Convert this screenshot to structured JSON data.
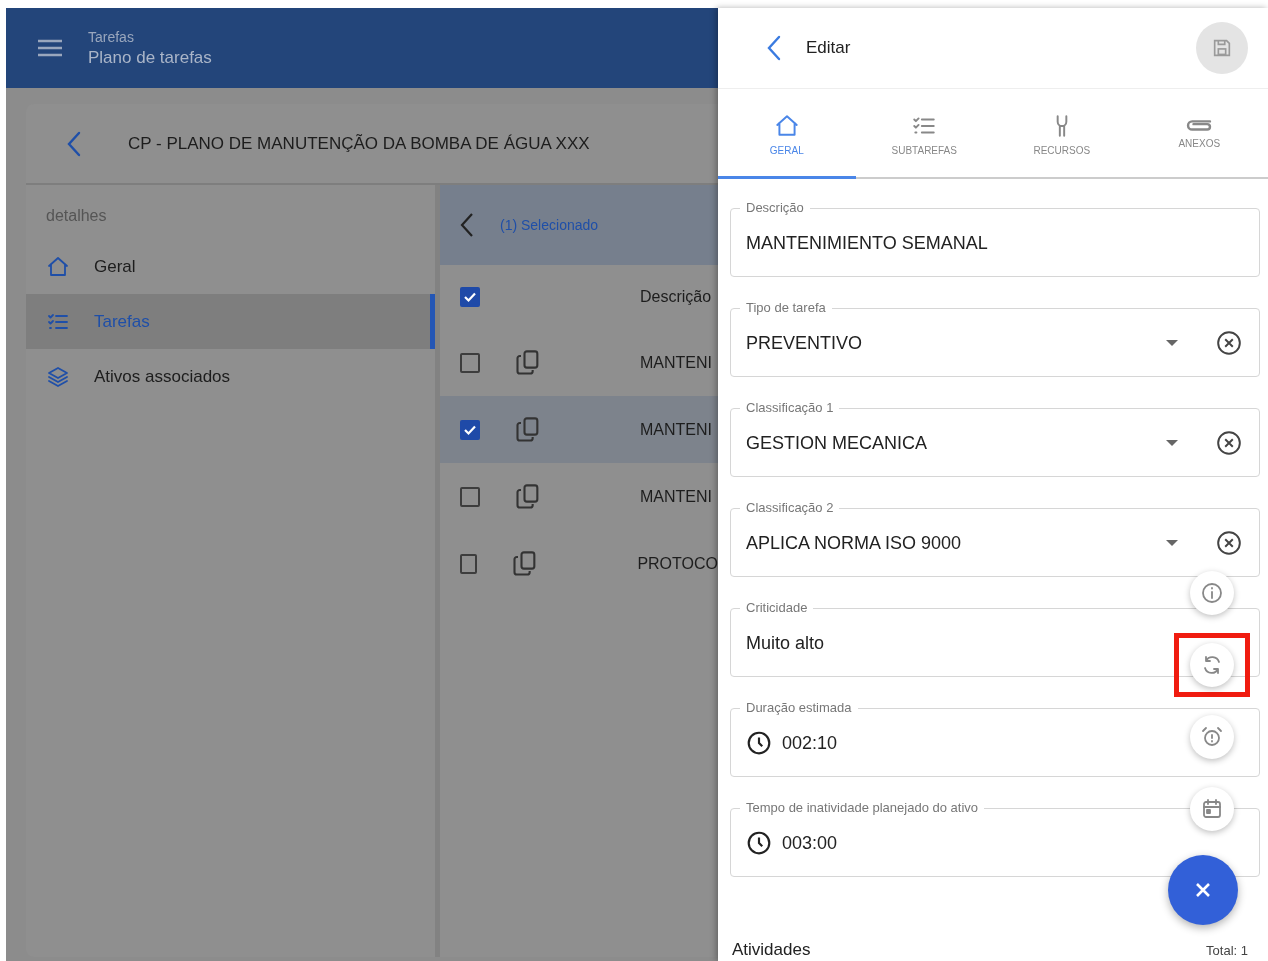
{
  "app_bar": {
    "section": "Tarefas",
    "title": "Plano de tarefas"
  },
  "plan": {
    "title": "CP - PLANO DE MANUTENÇÃO DA BOMBA DE ÁGUA XXX"
  },
  "sidebar": {
    "heading": "detalhes",
    "items": [
      {
        "label": "Geral",
        "selected": false
      },
      {
        "label": "Tarefas",
        "selected": true
      },
      {
        "label": "Ativos associados",
        "selected": false
      }
    ]
  },
  "task_table": {
    "selection": "(1) Selecionado",
    "header_checked": true,
    "column": "Descrição",
    "rows": [
      {
        "text": "MANTENI",
        "checked": false
      },
      {
        "text": "MANTENI",
        "checked": true
      },
      {
        "text": "MANTENI",
        "checked": false
      },
      {
        "text": "PROTOCO",
        "checked": false
      }
    ]
  },
  "editor": {
    "title": "Editar",
    "tabs": [
      {
        "label": "GERAL",
        "selected": true
      },
      {
        "label": "SUBTAREFAS",
        "selected": false
      },
      {
        "label": "RECURSOS",
        "selected": false
      },
      {
        "label": "ANEXOS",
        "selected": false
      }
    ],
    "fields": [
      {
        "kind": "text",
        "label": "Descrição",
        "value": "MANTENIMIENTO SEMANAL"
      },
      {
        "kind": "select",
        "label": "Tipo de tarefa",
        "value": "PREVENTIVO"
      },
      {
        "kind": "select",
        "label": "Classificação 1",
        "value": "GESTION MECANICA"
      },
      {
        "kind": "select",
        "label": "Classificação 2",
        "value": "APLICA NORMA ISO 9000"
      },
      {
        "kind": "text",
        "label": "Criticidade",
        "value": "Muito alto"
      },
      {
        "kind": "time",
        "label": "Duração estimada",
        "value": "002:10"
      },
      {
        "kind": "time",
        "label": "Tempo de inatividade planejado do ativo",
        "value": "003:00"
      }
    ],
    "footer": {
      "label": "Atividades",
      "total": "Total: 1"
    }
  },
  "speed_dial": [
    {
      "highlighted": false
    },
    {
      "highlighted": true
    },
    {
      "highlighted": false
    },
    {
      "highlighted": false
    }
  ]
}
